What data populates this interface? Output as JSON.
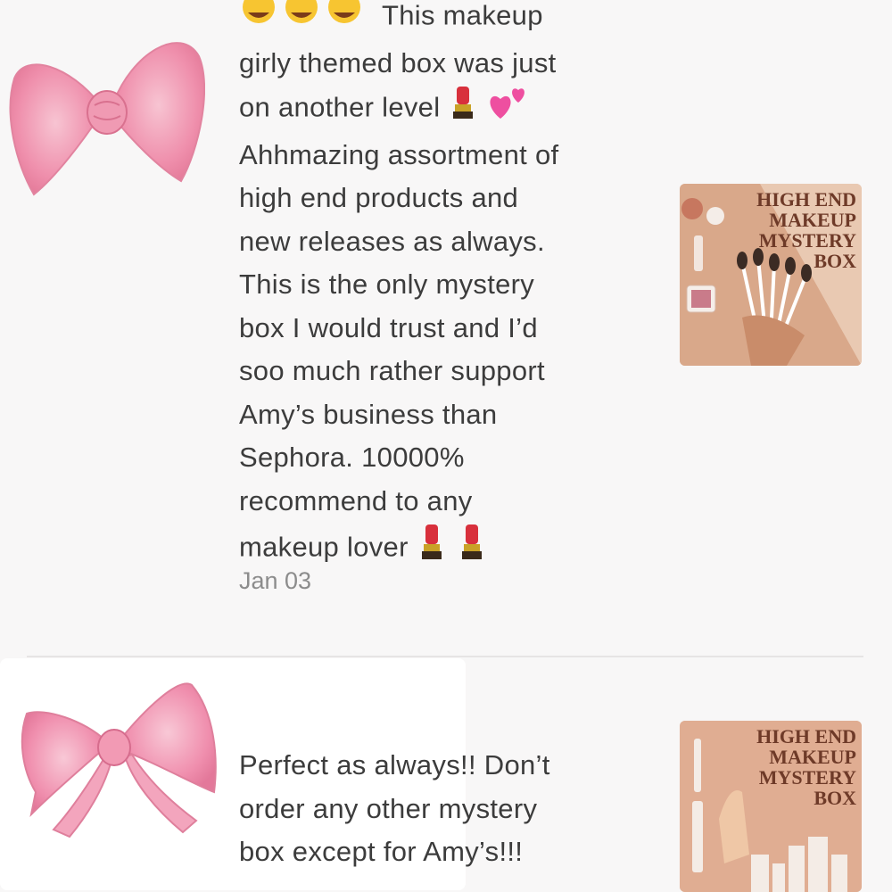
{
  "reviews": [
    {
      "text_line1": "This makeup",
      "text_line2": "girly themed box was just",
      "text_line3": "on another level",
      "text_rest": "Ahhmazing assortment of\nhigh end products and\nnew releases as always.\nThis is the only mystery\nbox I would trust and I’d\nsoo much rather support\nAmy’s business than\nSephora. 10000%\nrecommend to any",
      "text_last": "makeup lover",
      "date": "Jan 03",
      "product_title": "HIGH END\nMAKEUP\nMYSTERY\nBOX",
      "emoji_lead": "star-struck-icon",
      "emoji_mid": [
        "lipstick-icon",
        "two-hearts-icon"
      ],
      "emoji_end": [
        "lipstick-icon",
        "lipstick-icon"
      ]
    },
    {
      "text": "Perfect as always!! Don’t\norder any other mystery\nbox except for Amy’s!!!",
      "product_title": "HIGH END\nMAKEUP\nMYSTERY\nBOX"
    }
  ],
  "colors": {
    "background": "#f8f7f7",
    "text": "#3c3c3c",
    "date": "#8c8c8c",
    "bow_pink": "#f2a6bd",
    "thumb_peach": "#e7c3a8",
    "thumb_title": "#6e3a28"
  }
}
